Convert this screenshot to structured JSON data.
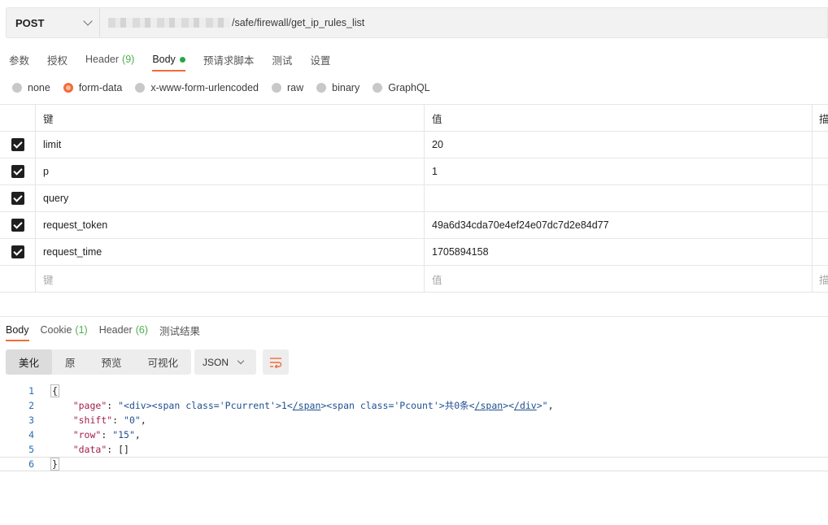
{
  "request": {
    "method": "POST",
    "url_suffix": "/safe/firewall/get_ip_rules_list"
  },
  "request_tabs": [
    {
      "label": "参数",
      "count": ""
    },
    {
      "label": "授权",
      "count": ""
    },
    {
      "label": "Header",
      "count": "(9)"
    },
    {
      "label": "Body",
      "count": ""
    },
    {
      "label": "预请求脚本",
      "count": ""
    },
    {
      "label": "测试",
      "count": ""
    },
    {
      "label": "设置",
      "count": ""
    }
  ],
  "body_types": [
    "none",
    "form-data",
    "x-www-form-urlencoded",
    "raw",
    "binary",
    "GraphQL"
  ],
  "params": {
    "header": {
      "key": "键",
      "value": "值",
      "desc": "描"
    },
    "rows": [
      {
        "key": "limit",
        "value": "20"
      },
      {
        "key": "p",
        "value": "1"
      },
      {
        "key": "query",
        "value": ""
      },
      {
        "key": "request_token",
        "value": "49a6d34cda70e4ef24e07dc7d2e84d77"
      },
      {
        "key": "request_time",
        "value": "1705894158"
      }
    ],
    "new_row": {
      "key": "键",
      "value": "值",
      "desc": "描"
    }
  },
  "response_tabs": [
    {
      "label": "Body",
      "count": ""
    },
    {
      "label": "Cookie",
      "count": "(1)"
    },
    {
      "label": "Header",
      "count": "(6)"
    },
    {
      "label": "测试结果",
      "count": ""
    }
  ],
  "view_modes": [
    "美化",
    "原",
    "预览",
    "可视化"
  ],
  "format": "JSON",
  "code": {
    "line_numbers": [
      "1",
      "2",
      "3",
      "4",
      "5",
      "6"
    ],
    "l1": "{",
    "l2_key": "\"page\"",
    "l2_a": "\"<div><span class='Pcurrent'>1<",
    "l2_b": "/span",
    "l2_c": "><span class='Pcount'>共0条<",
    "l2_d": "/span",
    "l2_e": "><",
    "l2_f": "/div",
    "l2_g": ">\"",
    "l3_key": "\"shift\"",
    "l3_val": "\"0\"",
    "l4_key": "\"row\"",
    "l4_val": "\"15\"",
    "l5_key": "\"data\"",
    "l5_val": "[]",
    "l6": "}"
  },
  "colors": {
    "accent": "#f26b3a",
    "dot": "#28a745",
    "count": "#4caf50"
  }
}
